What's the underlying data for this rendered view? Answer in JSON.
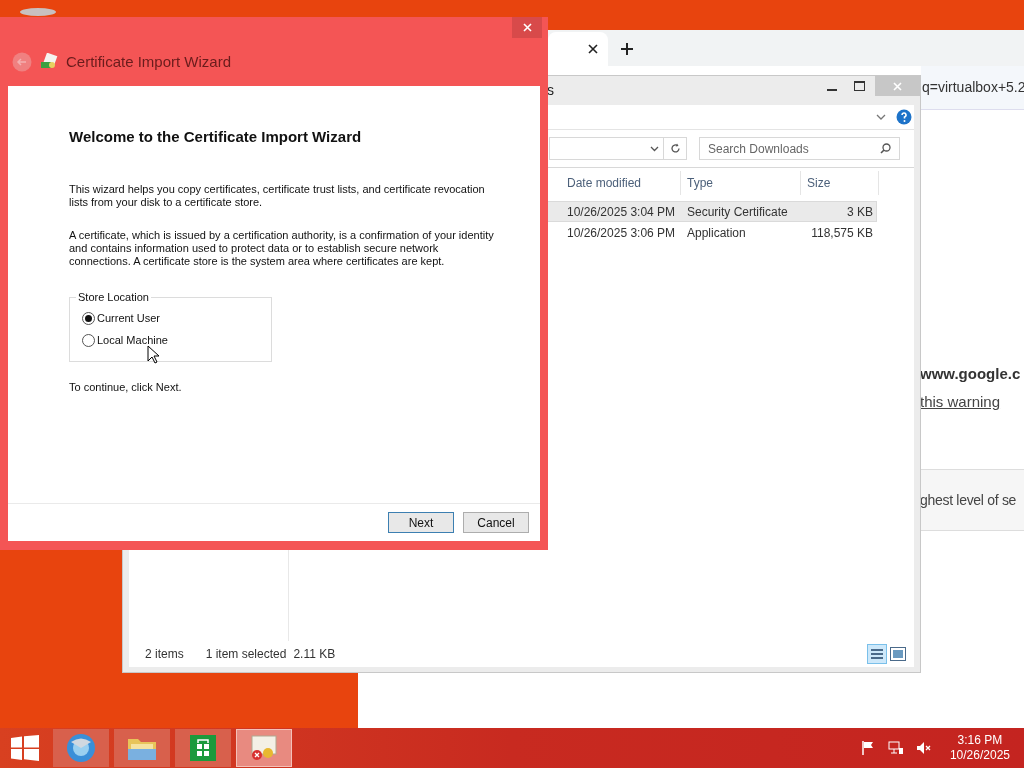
{
  "browser": {
    "address_fragment": "q=virtualbox+5.2",
    "page_texts": [
      {
        "kind": "bold",
        "text": "www.google.c"
      },
      {
        "kind": "link",
        "text": "this warning"
      },
      {
        "kind": "band",
        "text": "ghest level of se"
      }
    ]
  },
  "explorer": {
    "title_fragment": "s",
    "search": {
      "placeholder": "Search Downloads"
    },
    "columns": [
      "Date modified",
      "Type",
      "Size"
    ],
    "rows": [
      {
        "date": "10/26/2025 3:04 PM",
        "type": "Security Certificate",
        "size": "3 KB",
        "selected": true
      },
      {
        "date": "10/26/2025 3:06 PM",
        "type": "Application",
        "size": "118,575 KB",
        "selected": false
      }
    ],
    "status": {
      "count": "2 items",
      "selection": "1 item selected",
      "selection_size": "2.11 KB"
    }
  },
  "wizard": {
    "title": "Certificate Import Wizard",
    "heading": "Welcome to the Certificate Import Wizard",
    "paragraphs": [
      "This wizard helps you copy certificates, certificate trust lists, and certificate revocation lists from your disk to a certificate store.",
      "A certificate, which is issued by a certification authority, is a confirmation of your identity and contains information used to protect data or to establish secure network connections. A certificate store is the system area where certificates are kept."
    ],
    "store_location": {
      "legend": "Store Location",
      "options": [
        {
          "label": "Current User",
          "selected": true
        },
        {
          "label": "Local Machine",
          "selected": false
        }
      ]
    },
    "prompt": "To continue, click Next.",
    "buttons": [
      {
        "label": "Next",
        "focused": true
      },
      {
        "label": "Cancel",
        "focused": false
      }
    ]
  },
  "taskbar": {
    "apps": [
      {
        "kind": "browser",
        "selected": false
      },
      {
        "kind": "folder",
        "selected": false
      },
      {
        "kind": "store",
        "selected": false
      },
      {
        "kind": "certificate",
        "selected": true
      }
    ],
    "time": "3:16 PM",
    "date": "10/26/2025"
  }
}
